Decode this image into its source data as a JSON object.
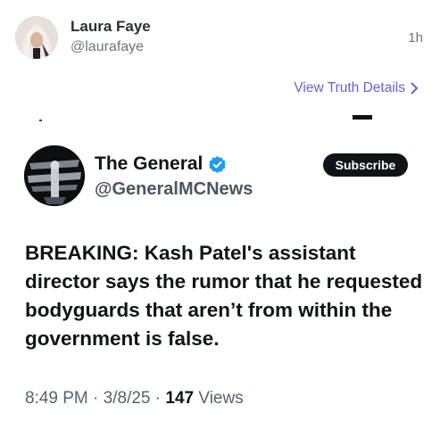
{
  "post": {
    "author_name": "Laura Faye",
    "author_handle": "@laurafaye",
    "time": "1h",
    "view_details_label": "View Truth Details"
  },
  "embedded_tweet": {
    "name": "The General",
    "handle": "@GeneralMCNews",
    "subscribe_label": "Subscribe",
    "body": "BREAKING: Kash Patel's assistant director says the rumor that he requested bodyguards that aren’t from within the government is false.",
    "time": "8:49 PM",
    "date": "3/8/25",
    "views_count": "147",
    "views_label": "Views",
    "separator": "·",
    "verified_color": "#1d9bf0"
  },
  "icons": {
    "details": "chevron-right-icon",
    "verified": "verified-badge-icon"
  }
}
